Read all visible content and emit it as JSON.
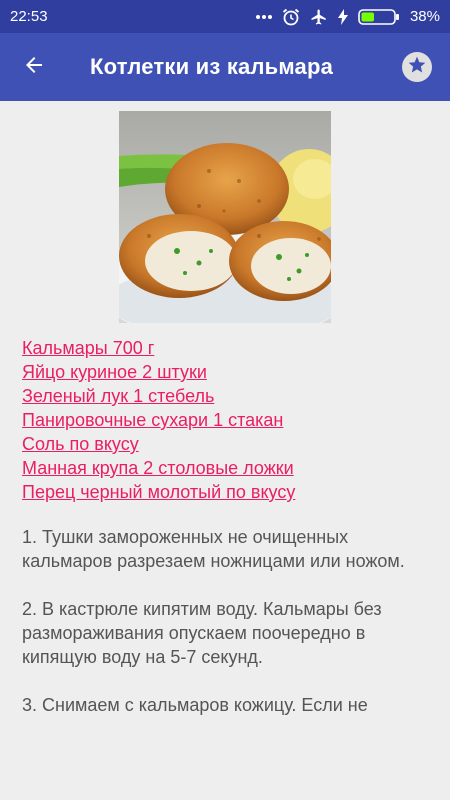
{
  "status_bar": {
    "time": "22:53",
    "battery": "38%",
    "icons": [
      "more-dots-icon",
      "alarm-icon",
      "airplane-icon",
      "charging-icon",
      "battery-icon"
    ]
  },
  "app_bar": {
    "title": "Котлетки из кальмара",
    "back_icon": "arrow-left-icon",
    "favorite_icon": "star-icon"
  },
  "recipe": {
    "photo_icon": "cutlets-photo",
    "ingredients": [
      "Кальмары 700 г",
      "Яйцо куриное 2 штуки",
      "Зеленый лук 1 стебель",
      "Панировочные сухари 1 стакан",
      "Соль по вкусу",
      "Манная крупа 2 столовые ложки",
      "Перец черный молотый по вкусу"
    ],
    "steps": [
      "1. Тушки замороженных не очищенных кальмаров разрезаем ножницами или ножом.",
      "2. В кастрюле кипятим воду. Кальмары без размораживания опускаем поочередно в кипящую воду на 5-7 секунд.",
      "3. Снимаем с кальмаров кожицу. Если не"
    ]
  },
  "colors": {
    "status_bar": "#303f9f",
    "app_bar": "#3f51b5",
    "link": "#e91e63",
    "background": "#eeeeee",
    "body_text": "#555555"
  }
}
